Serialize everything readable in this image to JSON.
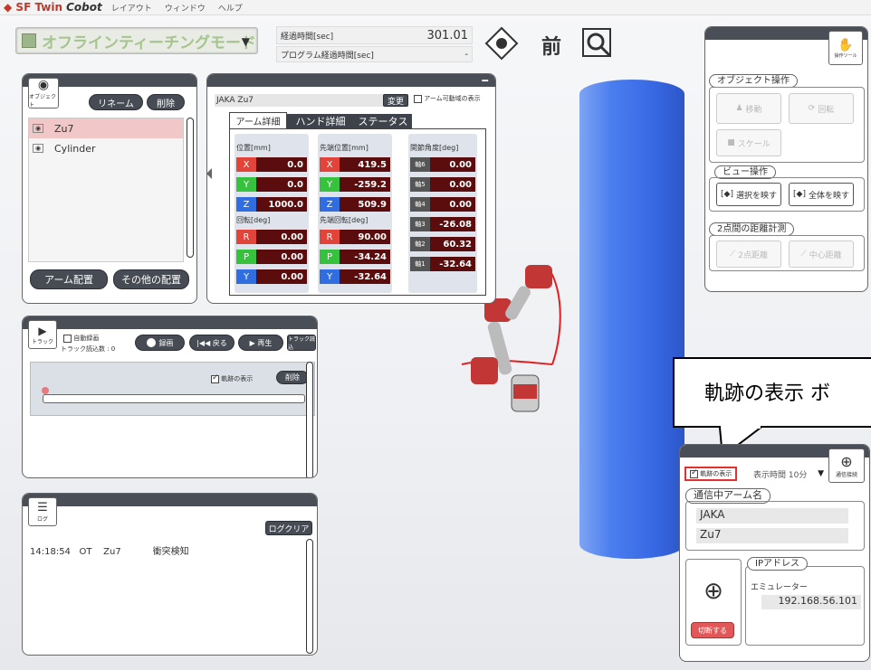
{
  "menubar": {
    "app": "SF Twin",
    "app2": "Cobot",
    "items": [
      "レイアウト",
      "ウィンドウ",
      "ヘルプ"
    ]
  },
  "mode": {
    "label": "オフラインティーチングモード"
  },
  "time": {
    "elapsed_label": "経過時間[sec]",
    "elapsed_value": "301.01",
    "program_label": "プログラム経過時間[sec]",
    "program_value": "-"
  },
  "toolbar": {
    "front_label": "前"
  },
  "object_panel": {
    "label": "オブジェクト",
    "rename": "リネーム",
    "delete": "削除",
    "items": [
      "Zu7",
      "Cylinder"
    ],
    "arm_place": "アーム配置",
    "other_place": "その他の配置"
  },
  "detail": {
    "name": "JAKA Zu7",
    "change": "変更",
    "show_range": "アーム可動域の表示",
    "tabs": [
      "アーム詳細",
      "ハンド詳細",
      "ステータス"
    ],
    "pos_label": "位置[mm]",
    "tip_label": "先端位置[mm]",
    "joint_label": "関節角度[deg]",
    "rot_label": "回転[deg]",
    "tiprot_label": "先端回転[deg]",
    "pos": [
      {
        "k": "X",
        "v": "0.0"
      },
      {
        "k": "Y",
        "v": "0.0"
      },
      {
        "k": "Z",
        "v": "1000.0"
      }
    ],
    "rot": [
      {
        "k": "R",
        "v": "0.00"
      },
      {
        "k": "P",
        "v": "0.00"
      },
      {
        "k": "Y",
        "v": "0.00"
      }
    ],
    "tip": [
      {
        "k": "X",
        "v": "419.5"
      },
      {
        "k": "Y",
        "v": "-259.2"
      },
      {
        "k": "Z",
        "v": "509.9"
      }
    ],
    "tiprot": [
      {
        "k": "R",
        "v": "90.00"
      },
      {
        "k": "P",
        "v": "-34.24"
      },
      {
        "k": "Y",
        "v": "-32.64"
      }
    ],
    "joints": [
      {
        "k": "軸6",
        "v": "0.00"
      },
      {
        "k": "軸5",
        "v": "0.00"
      },
      {
        "k": "軸4",
        "v": "0.00"
      },
      {
        "k": "軸3",
        "v": "-26.08"
      },
      {
        "k": "軸2",
        "v": "60.32"
      },
      {
        "k": "軸1",
        "v": "-32.64"
      }
    ]
  },
  "track": {
    "label": "トラック",
    "auto_record": "自動録画",
    "loaded": "トラック読込数 : 0",
    "record": "録画",
    "back": "戻る",
    "play": "再生",
    "load": "トラック読込",
    "show_traj": "軌跡の表示",
    "delete": "削除"
  },
  "log": {
    "label": "ログ",
    "clear": "ログクリア",
    "entries": [
      "14:18:54   OT    Zu7           衝突検知"
    ]
  },
  "ops": {
    "tool_label": "操作ツール",
    "obj_ops": "オブジェクト操作",
    "move": "移動",
    "rotate": "回転",
    "scale": "スケール",
    "view_ops": "ビュー操作",
    "fit_sel": "選択を映す",
    "fit_all": "全体を映す",
    "dist": "2点間の距離計測",
    "dist2": "2点距離",
    "center": "中心距離"
  },
  "comm": {
    "show_traj": "軌跡の表示",
    "display_time": "表示時間 10分",
    "conn_label": "通信接続",
    "arm_name_label": "通信中アーム名",
    "arm1": "JAKA",
    "arm2": "Zu7",
    "ip_label": "IPアドレス",
    "emulator": "エミュレーター",
    "ip": "192.168.56.101",
    "disconnect": "切断する"
  },
  "callout": {
    "text": "軌跡の表示  ボ"
  }
}
